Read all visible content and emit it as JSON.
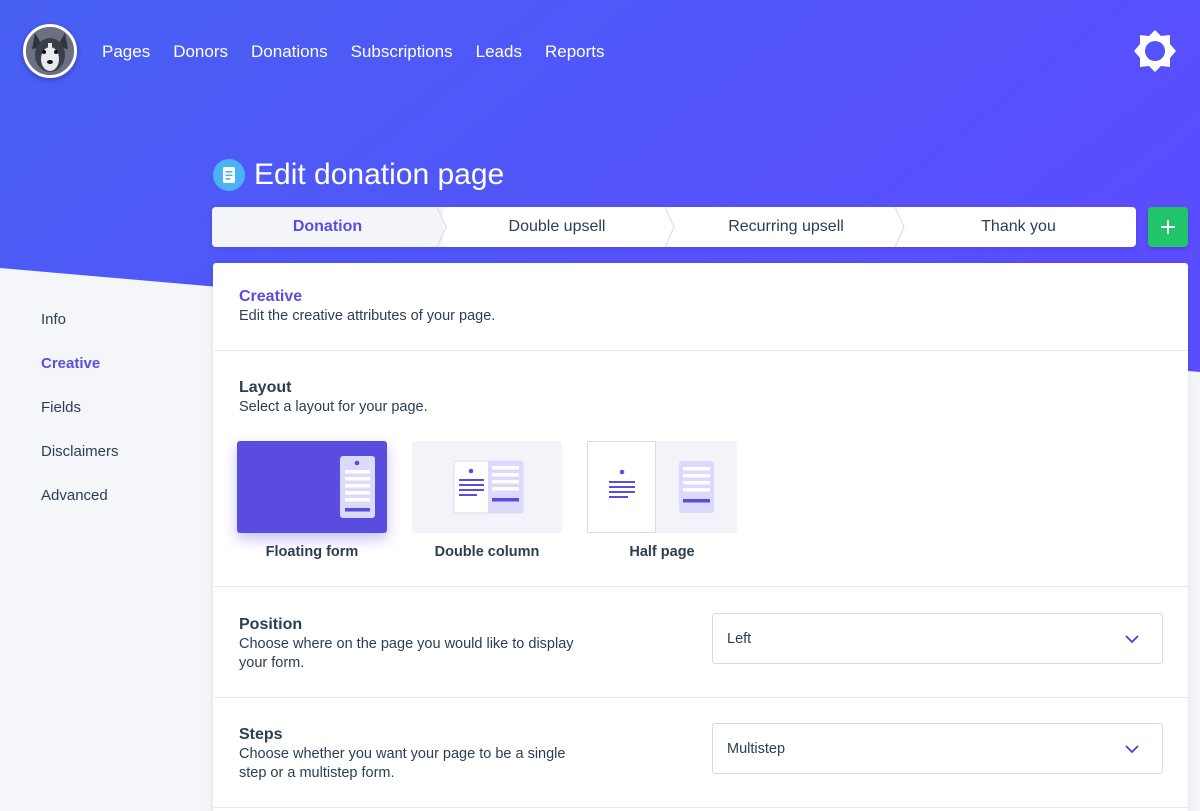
{
  "nav": {
    "items": [
      "Pages",
      "Donors",
      "Donations",
      "Subscriptions",
      "Leads",
      "Reports"
    ]
  },
  "page": {
    "title": "Edit donation page"
  },
  "tabs": [
    {
      "label": "Donation",
      "active": true
    },
    {
      "label": "Double upsell",
      "active": false
    },
    {
      "label": "Recurring upsell",
      "active": false
    },
    {
      "label": "Thank you",
      "active": false
    }
  ],
  "sidebar": {
    "items": [
      {
        "label": "Info",
        "active": false
      },
      {
        "label": "Creative",
        "active": true
      },
      {
        "label": "Fields",
        "active": false
      },
      {
        "label": "Disclaimers",
        "active": false
      },
      {
        "label": "Advanced",
        "active": false
      }
    ]
  },
  "creative": {
    "heading": "Creative",
    "description": "Edit the creative attributes of your page."
  },
  "layout": {
    "heading": "Layout",
    "description": "Select a layout for your page.",
    "options": [
      {
        "label": "Floating form",
        "selected": true
      },
      {
        "label": "Double column",
        "selected": false
      },
      {
        "label": "Half page",
        "selected": false
      }
    ]
  },
  "position": {
    "heading": "Position",
    "description_line1": "Choose where on the page you would like to display",
    "description_line2": "your form.",
    "value": "Left"
  },
  "steps": {
    "heading": "Steps",
    "description_line1": "Choose whether you want your page to be a single",
    "description_line2": "step or a multistep form.",
    "value": "Multistep"
  },
  "colors": {
    "gradient_start": "#4a5bf0",
    "gradient_end": "#5b4cff",
    "accent": "#5b4ce0",
    "add_button": "#22c46a",
    "title_icon": "#4ab3f4"
  },
  "icons": {
    "settings": "gear-icon",
    "add": "plus-icon",
    "title": "document-icon",
    "dropdown": "chevron-down-icon"
  }
}
